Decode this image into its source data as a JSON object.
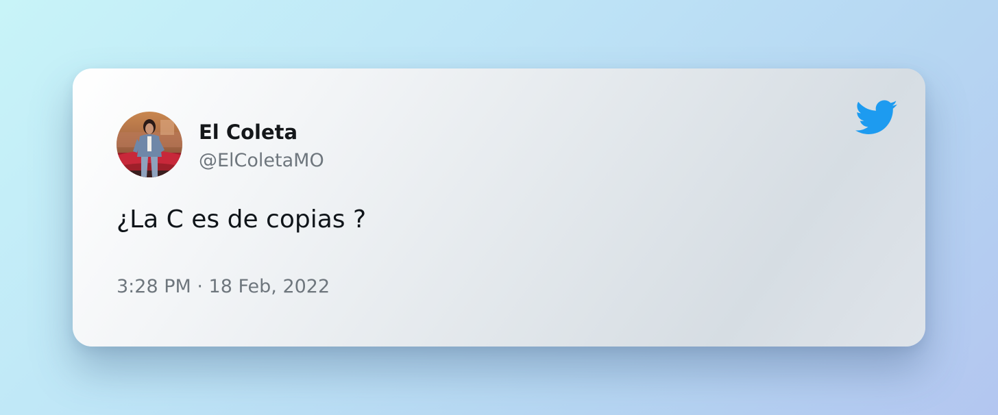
{
  "tweet": {
    "display_name": "El Coleta",
    "handle": "@ElColetaMO",
    "text": "¿La C es de copias ?",
    "timestamp": "3:28 PM · 18 Feb, 2022"
  },
  "icons": {
    "brand": "twitter-bird-icon",
    "avatar": "profile-photo"
  },
  "colors": {
    "brand_blue": "#1d9bf0",
    "name_text": "#14171a",
    "secondary_text": "#6e767d"
  }
}
